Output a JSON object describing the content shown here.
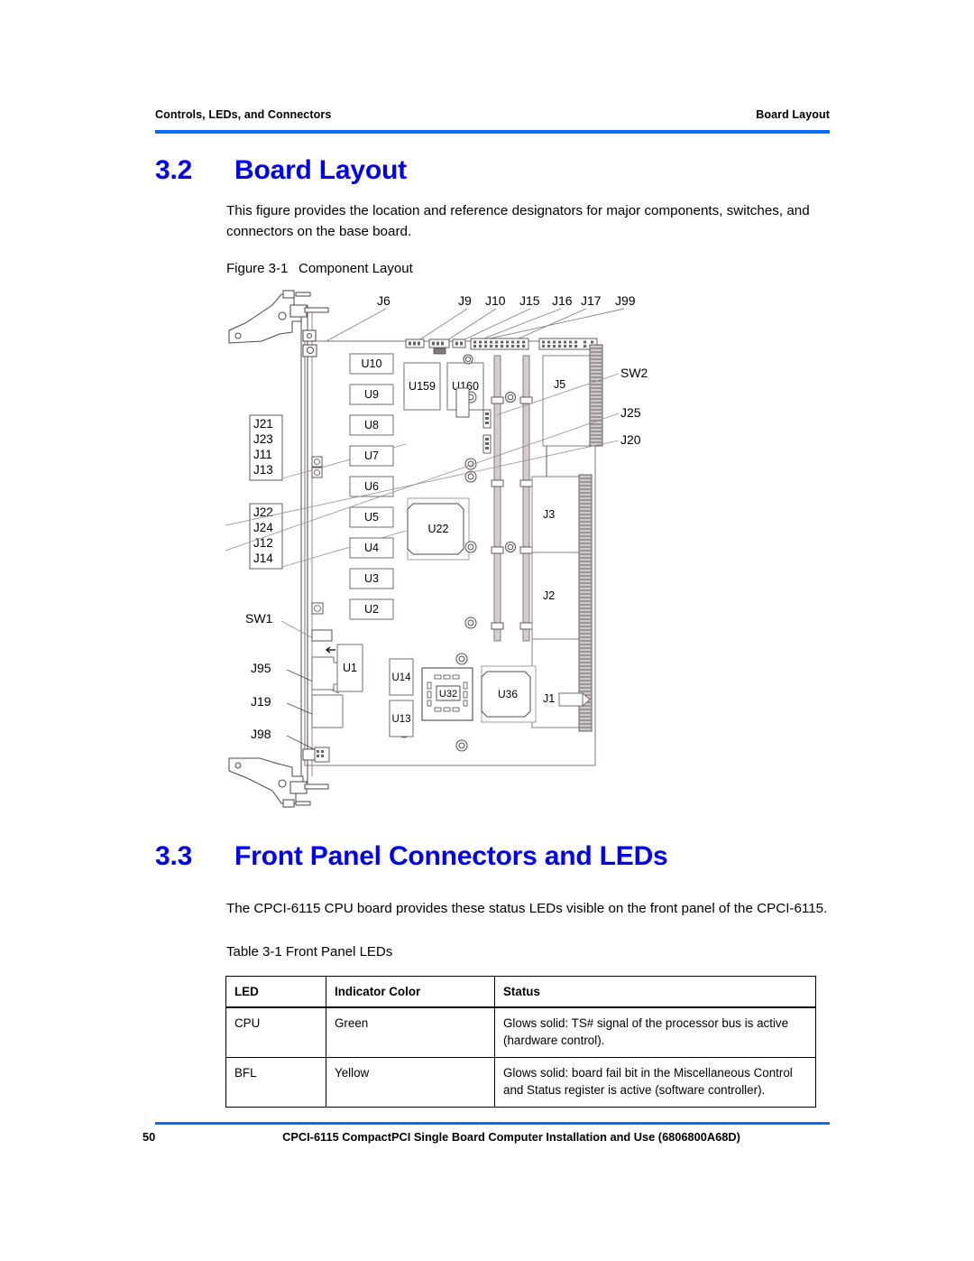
{
  "header": {
    "left": "Controls, LEDs, and Connectors",
    "right": "Board Layout",
    "rule_color": "#0b6bfb"
  },
  "sections": [
    {
      "number": "3.2",
      "title": "Board Layout",
      "body": "This figure provides the location and reference designators for major components, switches, and connectors on the base board.",
      "color": "#0000ee"
    },
    {
      "number": "3.3",
      "title": "Front Panel Connectors and LEDs",
      "body": "The CPCI-6115 CPU board provides these status LEDs visible on the front panel of the CPCI-6115.",
      "color": "#0000ee"
    }
  ],
  "figure": {
    "caption_label": "Figure 3-1",
    "caption_text": "Component Layout",
    "top_labels": [
      "J6",
      "J9",
      "J10",
      "J15",
      "J16",
      "J17",
      "J99"
    ],
    "left_group_1": [
      "J21",
      "J23",
      "J11",
      "J13"
    ],
    "left_group_2": [
      "J22",
      "J24",
      "J12",
      "J14"
    ],
    "left_labels": [
      "SW1",
      "J95",
      "J19",
      "J98"
    ],
    "right_labels": [
      "SW2",
      "J25",
      "J20"
    ],
    "chip_column": [
      "U10",
      "U9",
      "U8",
      "U7",
      "U6",
      "U5",
      "U4",
      "U3",
      "U2"
    ],
    "chips": [
      "U159",
      "U160",
      "U22",
      "U1",
      "U14",
      "U13",
      "U32",
      "U36"
    ],
    "connectors": [
      "J5",
      "J3",
      "J2",
      "J1"
    ]
  },
  "table": {
    "caption": "Table 3-1 Front Panel LEDs",
    "columns": [
      "LED",
      "Indicator Color",
      "Status"
    ],
    "rows": [
      {
        "led": "CPU",
        "color": "Green",
        "status": "Glows solid: TS# signal of the processor bus is active (hardware control)."
      },
      {
        "led": "BFL",
        "color": "Yellow",
        "status": "Glows solid: board fail bit in the Miscellaneous Control and Status register is active (software controller)."
      }
    ]
  },
  "footer": {
    "page_number": "50",
    "title": "CPCI-6115 CompactPCI Single Board Computer Installation and Use (6806800A68D)"
  }
}
